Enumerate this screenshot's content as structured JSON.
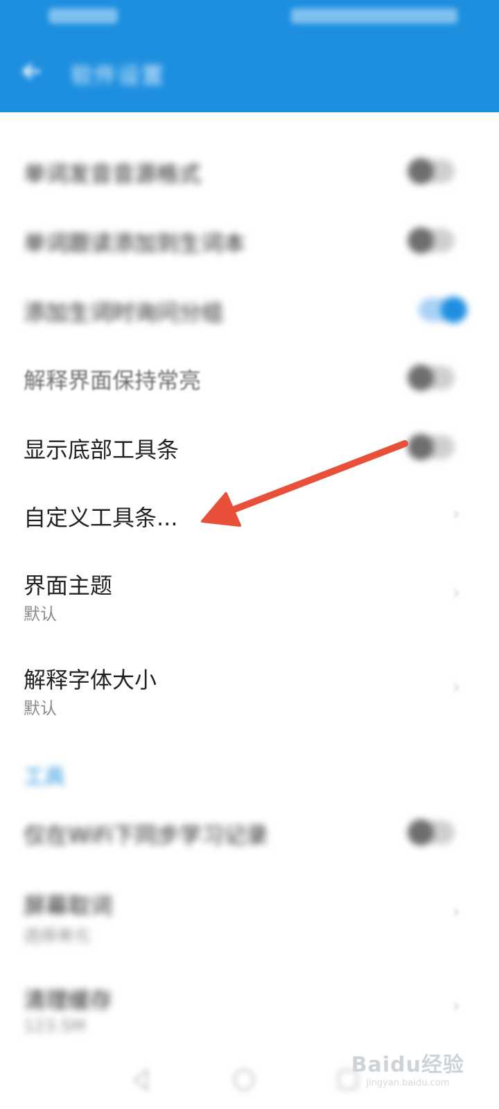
{
  "appbar": {
    "title": "软件设置",
    "color": "#1e8fdf"
  },
  "settings": [
    {
      "label": "单词发音音源格式",
      "toggle": "off",
      "obscured": true
    },
    {
      "label": "单词跟读添加到生词本",
      "toggle": "off",
      "obscured": true
    },
    {
      "label": "添加生词时询问分组",
      "toggle": "on",
      "obscured": true
    },
    {
      "label": "解释界面保持常亮",
      "toggle": "off",
      "obscured": false
    },
    {
      "label": "显示底部工具条",
      "toggle": "off",
      "obscured": false
    },
    {
      "label": "自定义工具条...",
      "chevron": true,
      "obscured": false
    },
    {
      "label": "界面主题",
      "sub": "默认",
      "chevron": true,
      "obscured": false
    },
    {
      "label": "解释字体大小",
      "sub": "默认",
      "chevron": true,
      "obscured": false
    }
  ],
  "tools_section": {
    "header": "工具",
    "items": [
      {
        "label": "仅在WiFi下同步学习记录",
        "toggle": "off"
      },
      {
        "label": "屏幕取词",
        "sub": "选择单元"
      },
      {
        "label": "清理缓存",
        "sub": "123.5M"
      }
    ]
  },
  "annotation": {
    "arrow_color": "#e8503a"
  },
  "watermark": {
    "text": "Baidu经验",
    "url": "jingyan.baidu.com"
  }
}
